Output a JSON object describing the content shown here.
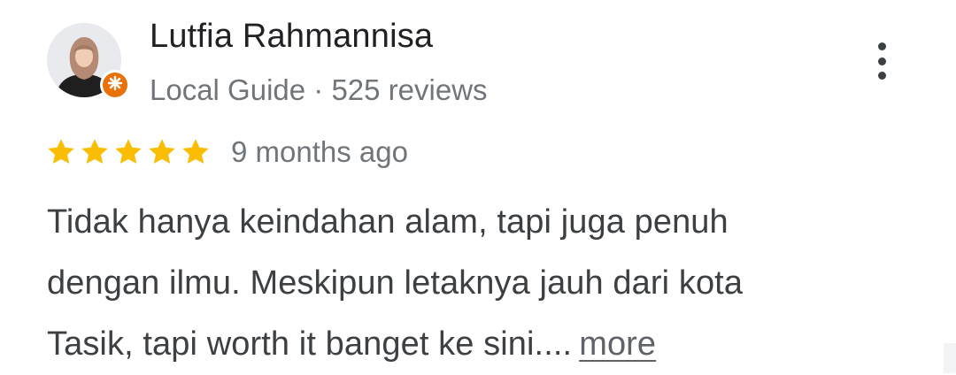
{
  "review": {
    "reviewer_name": "Lutfia Rahmannisa",
    "reviewer_meta": "Local Guide · 525 reviews",
    "rating": 5,
    "rating_max": 5,
    "star_color": "#fbbc04",
    "date": "9 months ago",
    "text_lines": [
      "Tidak hanya keindahan alam, tapi juga penuh",
      "dengan ilmu. Meskipun letaknya jauh dari kota",
      "Tasik, tapi worth it banget ke sini...."
    ],
    "more_label": "more"
  },
  "icons": {
    "badge": "local-guide-star-icon",
    "menu": "more-vert-icon",
    "star": "star-icon"
  },
  "colors": {
    "badge_orange": "#e8710a",
    "name_text": "#202124",
    "meta_text": "#70757a",
    "body_text": "#3c4043"
  }
}
